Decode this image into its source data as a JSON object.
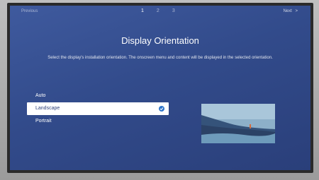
{
  "top_bar": {
    "previous_label": "Previous",
    "steps": [
      "1",
      "2",
      "3"
    ],
    "active_step": 1,
    "next_label": "Next"
  },
  "page": {
    "title": "Display Orientation",
    "description": "Select the display's installation orientation. The onscreen menu and content will be displayed in the selected orientation."
  },
  "options": [
    {
      "label": "Auto",
      "selected": false
    },
    {
      "label": "Landscape",
      "selected": true
    },
    {
      "label": "Portrait",
      "selected": false
    }
  ],
  "preview": {
    "icon": "landscape-preview-image"
  },
  "colors": {
    "screen": "#3f5a9e",
    "accent": "#2e74c9"
  }
}
